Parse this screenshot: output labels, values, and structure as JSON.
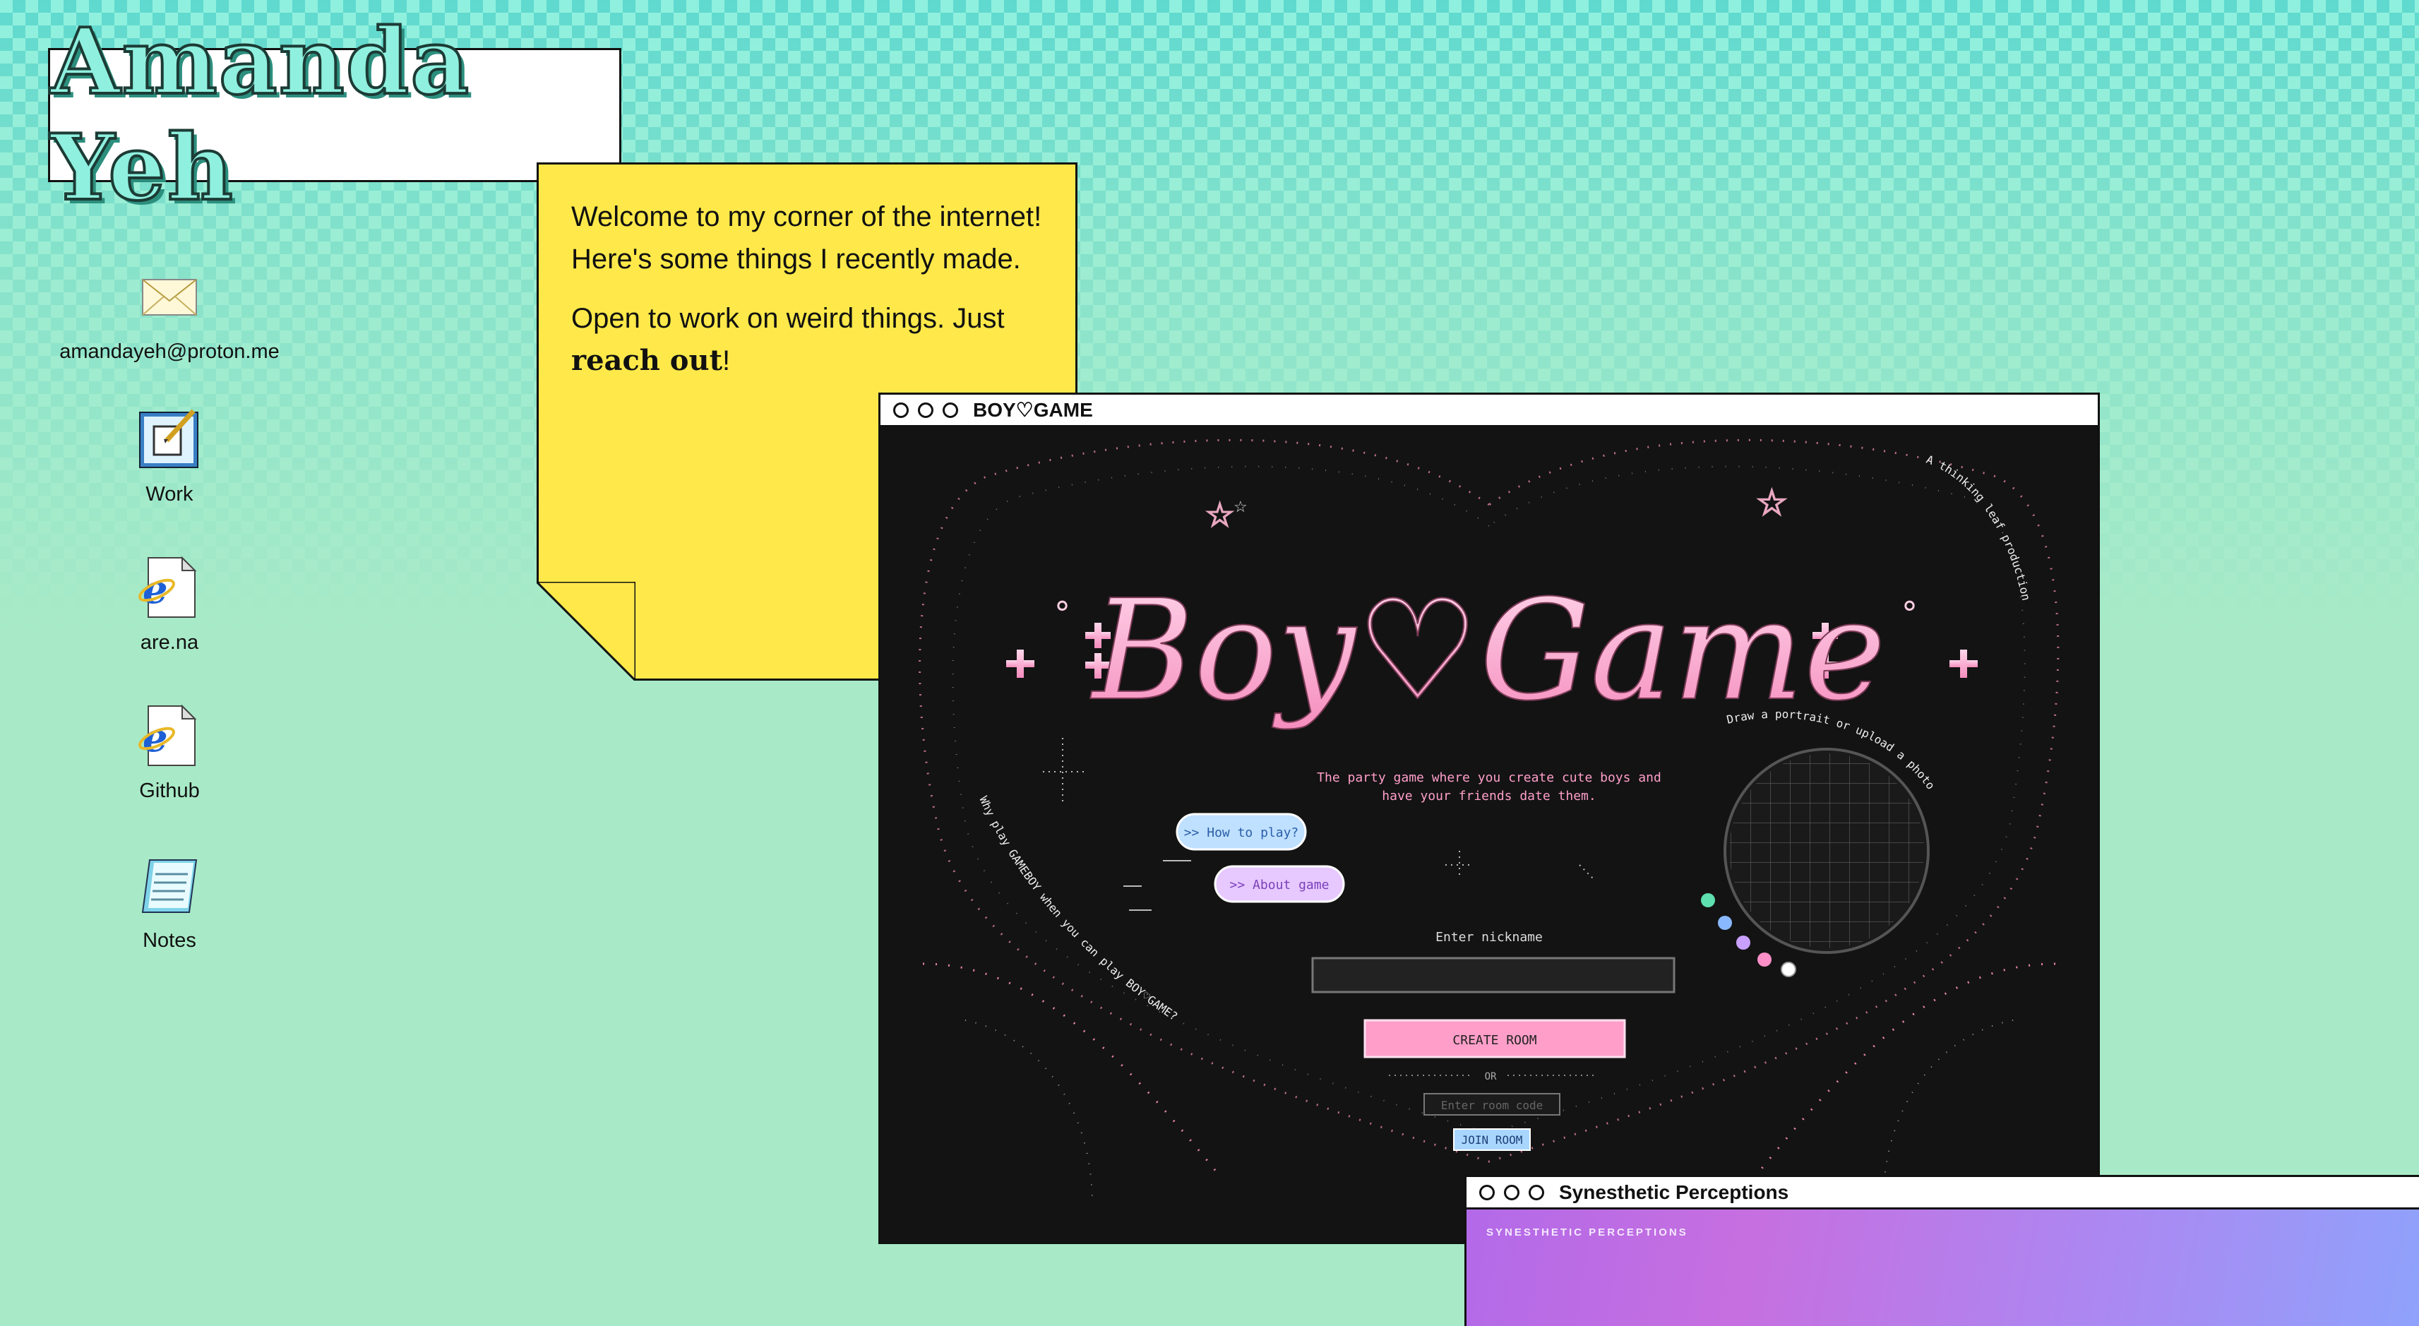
{
  "site": {
    "name": "Amanda Yeh"
  },
  "note": {
    "line1": "Welcome to my corner of the internet!",
    "line2": "Here's some things I recently made.",
    "line3_prefix": "Open to work on weird things. Just",
    "line3_link": "reach out",
    "line3_suffix": "!"
  },
  "desktop_icons": [
    {
      "label": "amandayeh@proton.me",
      "icon": "mail-envelope-icon"
    },
    {
      "label": "Work",
      "icon": "notepad-edit-icon"
    },
    {
      "label": "are.na",
      "icon": "internet-explorer-icon"
    },
    {
      "label": "Github",
      "icon": "internet-explorer-icon"
    },
    {
      "label": "Notes",
      "icon": "notepad-icon"
    }
  ],
  "boy_window": {
    "title": "BOY♡GAME",
    "logo": "Boy♡Game",
    "tagline_1": "The party game where you create cute boys and",
    "tagline_2": "have your friends date them.",
    "how_to_play": ">> How to play?",
    "about_game": ">> About game",
    "enter_nickname": "Enter nickname",
    "create_room": "CREATE ROOM",
    "or": "OR",
    "room_code_placeholder": "Enter room code",
    "join_room": "JOIN ROOM",
    "arc_top_right": "A thinking leaf production",
    "arc_draw": "Draw a portrait or upload a photo",
    "arc_left": "Why play GAMEBOY when you can play BOY♡GAME?",
    "palette_colors": [
      "#5fe0b0",
      "#8ab8ff",
      "#c9a0ff",
      "#ff8fc8",
      "#ffffff"
    ]
  },
  "syn_window": {
    "title": "Synesthetic Perceptions",
    "banner": "SYNESTHETIC PERCEPTIONS"
  },
  "colors": {
    "sticky": "#ffe94a",
    "pink": "#ff9fc9",
    "accent_blue": "#a9d6ff",
    "accent_purple": "#d9b3ff"
  }
}
